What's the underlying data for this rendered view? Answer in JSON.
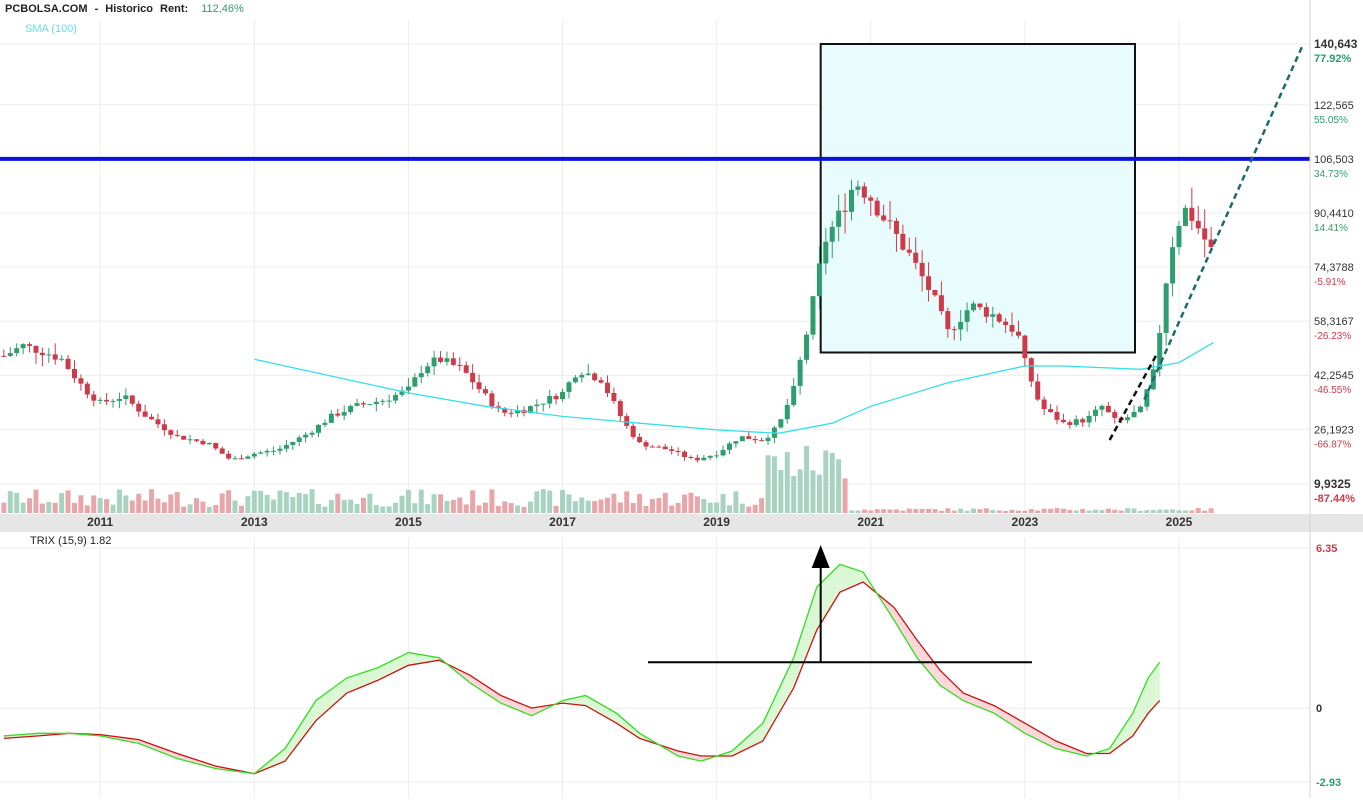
{
  "header": {
    "site": "PCBOLSA.COM",
    "separator": "-",
    "mode": "Historico",
    "rent_label": "Rent:",
    "rent_value": "112,46%"
  },
  "colors": {
    "up": "#2e9e6e",
    "down": "#cc3b4a",
    "sma": "#35e0e8",
    "level_line": "#0a14d6",
    "box_fill": "#e9fcfd",
    "trix_green": "#33dd22",
    "trix_red": "#cc1111",
    "vol_up": "#a9d3c1",
    "vol_down": "#e8a6aa",
    "axis_positive": "#2e9e6e",
    "axis_negative": "#cc3b4a"
  },
  "chart_data": [
    {
      "type": "candlestick",
      "sma_label": "SMA (100)",
      "x_ticks": [
        "2011",
        "2013",
        "2015",
        "2017",
        "2019",
        "2021",
        "2023",
        "2025"
      ],
      "y_ticks": [
        {
          "price": "140,643",
          "pct": "77.92%"
        },
        {
          "price": "122,565",
          "pct": "55.05%"
        },
        {
          "price": "106,503",
          "pct": "34.73%"
        },
        {
          "price": "90,4410",
          "pct": "14.41%"
        },
        {
          "price": "74,3788",
          "pct": "-5.91%"
        },
        {
          "price": "58,3167",
          "pct": "-26.23%"
        },
        {
          "price": "42,2545",
          "pct": "-46.55%"
        },
        {
          "price": "26,1923",
          "pct": "-66.87%"
        },
        {
          "price": "9,9325",
          "pct": "-87.44%"
        }
      ],
      "ylim": [
        9.9325,
        140.643
      ],
      "xlim": [
        2009.7,
        2026.7
      ],
      "price_path": [
        [
          2009.75,
          48
        ],
        [
          2010.0,
          51
        ],
        [
          2010.3,
          49
        ],
        [
          2010.5,
          47
        ],
        [
          2010.8,
          38
        ],
        [
          2011.0,
          34
        ],
        [
          2011.3,
          36
        ],
        [
          2011.6,
          30
        ],
        [
          2012.0,
          24
        ],
        [
          2012.4,
          22
        ],
        [
          2012.7,
          17
        ],
        [
          2013.0,
          19
        ],
        [
          2013.3,
          20
        ],
        [
          2013.7,
          25
        ],
        [
          2014.0,
          30
        ],
        [
          2014.3,
          33
        ],
        [
          2014.7,
          35
        ],
        [
          2015.0,
          38
        ],
        [
          2015.2,
          45
        ],
        [
          2015.4,
          47
        ],
        [
          2015.7,
          44
        ],
        [
          2016.0,
          36
        ],
        [
          2016.2,
          31
        ],
        [
          2016.5,
          32
        ],
        [
          2016.8,
          35
        ],
        [
          2017.0,
          37
        ],
        [
          2017.2,
          44
        ],
        [
          2017.5,
          41
        ],
        [
          2017.8,
          28
        ],
        [
          2018.0,
          22
        ],
        [
          2018.4,
          20
        ],
        [
          2018.7,
          17
        ],
        [
          2019.0,
          19
        ],
        [
          2019.3,
          24
        ],
        [
          2019.6,
          23
        ],
        [
          2019.8,
          27
        ],
        [
          2020.0,
          38
        ],
        [
          2020.2,
          58
        ],
        [
          2020.4,
          82
        ],
        [
          2020.6,
          90
        ],
        [
          2020.8,
          100
        ],
        [
          2021.0,
          95
        ],
        [
          2021.2,
          88
        ],
        [
          2021.5,
          78
        ],
        [
          2021.8,
          66
        ],
        [
          2022.0,
          55
        ],
        [
          2022.3,
          63
        ],
        [
          2022.6,
          60
        ],
        [
          2022.9,
          55
        ],
        [
          2023.0,
          46
        ],
        [
          2023.2,
          33
        ],
        [
          2023.5,
          28
        ],
        [
          2023.8,
          29
        ],
        [
          2024.0,
          33
        ],
        [
          2024.2,
          28
        ],
        [
          2024.5,
          32
        ],
        [
          2024.7,
          45
        ],
        [
          2024.8,
          66
        ],
        [
          2024.95,
          86
        ],
        [
          2025.1,
          92
        ],
        [
          2025.3,
          84
        ],
        [
          2025.45,
          78
        ]
      ],
      "sma_path": [
        [
          2013.0,
          47
        ],
        [
          2014.0,
          42
        ],
        [
          2015.0,
          37
        ],
        [
          2016.0,
          33
        ],
        [
          2017.0,
          30
        ],
        [
          2018.0,
          28
        ],
        [
          2019.0,
          26
        ],
        [
          2019.8,
          25
        ],
        [
          2020.5,
          28
        ],
        [
          2021.0,
          33
        ],
        [
          2022.0,
          40
        ],
        [
          2023.0,
          45
        ],
        [
          2023.5,
          45
        ],
        [
          2024.5,
          44
        ],
        [
          2025.0,
          46
        ],
        [
          2025.45,
          52
        ]
      ],
      "levels": [
        106.503
      ],
      "box": {
        "x": [
          2020.35,
          2027.3
        ],
        "y": [
          49,
          140.643
        ]
      },
      "trendlines": [
        {
          "points": [
            [
              2024.1,
              23
            ],
            [
              2024.7,
              48
            ]
          ],
          "color": "#111111"
        },
        {
          "points": [
            [
              2024.55,
              35
            ],
            [
              2026.6,
              140
            ]
          ],
          "color": "#1b6b6b"
        }
      ]
    },
    {
      "type": "line",
      "title": "TRIX (15,9) 1.82",
      "y_ticks": [
        "6.35",
        "0",
        "-2.93"
      ],
      "ylim": [
        -2.93,
        6.35
      ],
      "trix": [
        [
          2009.75,
          -1.1
        ],
        [
          2010.2,
          -1.0
        ],
        [
          2010.6,
          -1.0
        ],
        [
          2011.0,
          -1.1
        ],
        [
          2011.5,
          -1.4
        ],
        [
          2012.0,
          -2.0
        ],
        [
          2012.5,
          -2.4
        ],
        [
          2013.0,
          -2.6
        ],
        [
          2013.4,
          -1.6
        ],
        [
          2013.8,
          0.3
        ],
        [
          2014.2,
          1.2
        ],
        [
          2014.6,
          1.6
        ],
        [
          2015.0,
          2.2
        ],
        [
          2015.4,
          2.0
        ],
        [
          2015.8,
          1.0
        ],
        [
          2016.2,
          0.2
        ],
        [
          2016.6,
          -0.3
        ],
        [
          2017.0,
          0.3
        ],
        [
          2017.3,
          0.5
        ],
        [
          2017.7,
          -0.2
        ],
        [
          2018.0,
          -1.0
        ],
        [
          2018.5,
          -1.9
        ],
        [
          2018.8,
          -2.1
        ],
        [
          2019.2,
          -1.7
        ],
        [
          2019.6,
          -0.6
        ],
        [
          2020.0,
          2.0
        ],
        [
          2020.3,
          4.8
        ],
        [
          2020.6,
          5.7
        ],
        [
          2020.9,
          5.4
        ],
        [
          2021.3,
          3.5
        ],
        [
          2021.6,
          2.0
        ],
        [
          2021.9,
          0.9
        ],
        [
          2022.2,
          0.3
        ],
        [
          2022.6,
          -0.2
        ],
        [
          2023.0,
          -1.0
        ],
        [
          2023.4,
          -1.6
        ],
        [
          2023.8,
          -1.9
        ],
        [
          2024.1,
          -1.6
        ],
        [
          2024.4,
          -0.2
        ],
        [
          2024.6,
          1.2
        ],
        [
          2024.75,
          1.82
        ]
      ],
      "signal": [
        [
          2009.75,
          -1.2
        ],
        [
          2010.2,
          -1.1
        ],
        [
          2010.6,
          -1.0
        ],
        [
          2011.0,
          -1.05
        ],
        [
          2011.5,
          -1.25
        ],
        [
          2012.0,
          -1.8
        ],
        [
          2012.5,
          -2.3
        ],
        [
          2013.0,
          -2.6
        ],
        [
          2013.4,
          -2.1
        ],
        [
          2013.8,
          -0.5
        ],
        [
          2014.2,
          0.6
        ],
        [
          2014.6,
          1.1
        ],
        [
          2015.0,
          1.7
        ],
        [
          2015.4,
          1.9
        ],
        [
          2015.8,
          1.3
        ],
        [
          2016.2,
          0.5
        ],
        [
          2016.6,
          0.0
        ],
        [
          2017.0,
          0.2
        ],
        [
          2017.3,
          0.1
        ],
        [
          2017.7,
          -0.6
        ],
        [
          2018.0,
          -1.2
        ],
        [
          2018.5,
          -1.7
        ],
        [
          2018.8,
          -1.9
        ],
        [
          2019.2,
          -1.9
        ],
        [
          2019.6,
          -1.3
        ],
        [
          2020.0,
          0.8
        ],
        [
          2020.3,
          3.1
        ],
        [
          2020.6,
          4.6
        ],
        [
          2020.9,
          5.0
        ],
        [
          2021.3,
          4.0
        ],
        [
          2021.6,
          2.7
        ],
        [
          2021.9,
          1.5
        ],
        [
          2022.2,
          0.6
        ],
        [
          2022.6,
          0.1
        ],
        [
          2023.0,
          -0.6
        ],
        [
          2023.4,
          -1.3
        ],
        [
          2023.8,
          -1.8
        ],
        [
          2024.1,
          -1.8
        ],
        [
          2024.4,
          -1.1
        ],
        [
          2024.6,
          -0.2
        ],
        [
          2024.75,
          0.3
        ]
      ],
      "hline_y": 1.82,
      "arrow": {
        "x": 2020.35,
        "from": 1.82,
        "to": 6.35
      }
    }
  ]
}
